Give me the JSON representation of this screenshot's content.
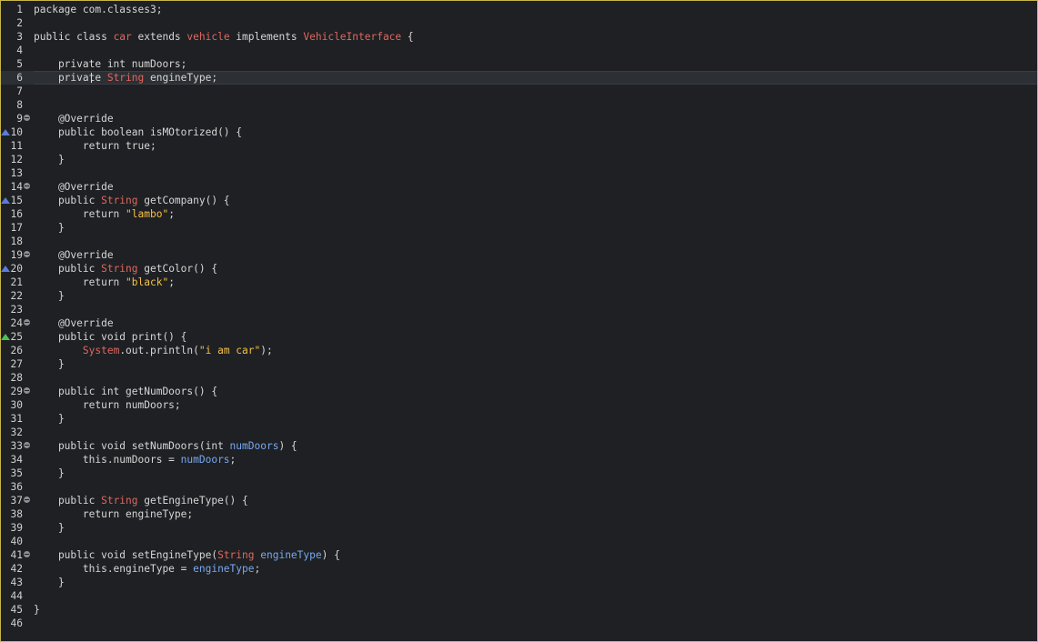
{
  "editor": {
    "border_color": "#c8b54a",
    "background": "#1e2023",
    "colors": {
      "default": "#d6d6d6",
      "type": "#e0675f",
      "string": "#f5c049",
      "field": "#79a8ee",
      "line_number": "#d0d0d0",
      "marker_blue": "#5b7cd8",
      "marker_green": "#4fbf57"
    },
    "current_line": 6,
    "lines": [
      {
        "n": "1",
        "tokens": [
          {
            "t": "package com.classes3;",
            "c": "default"
          }
        ]
      },
      {
        "n": "2",
        "tokens": []
      },
      {
        "n": "3",
        "tokens": [
          {
            "t": "public class ",
            "c": "default"
          },
          {
            "t": "car",
            "c": "type"
          },
          {
            "t": " extends ",
            "c": "default"
          },
          {
            "t": "vehicle",
            "c": "type"
          },
          {
            "t": " implements ",
            "c": "default"
          },
          {
            "t": "VehicleInterface",
            "c": "type"
          },
          {
            "t": " {",
            "c": "default"
          }
        ]
      },
      {
        "n": "4",
        "tokens": []
      },
      {
        "n": "5",
        "tokens": [
          {
            "t": "    private int numDoors;",
            "c": "default"
          }
        ]
      },
      {
        "n": "6",
        "tokens": [
          {
            "t": "    private ",
            "c": "default"
          },
          {
            "t": "String",
            "c": "type"
          },
          {
            "t": " engineType;",
            "c": "default"
          }
        ]
      },
      {
        "n": "7",
        "tokens": []
      },
      {
        "n": "8",
        "tokens": []
      },
      {
        "n": "9",
        "fold": true,
        "tokens": [
          {
            "t": "    @Override",
            "c": "default"
          }
        ]
      },
      {
        "n": "10",
        "marker": "blue",
        "tokens": [
          {
            "t": "    public boolean isMOtorized() {",
            "c": "default"
          }
        ]
      },
      {
        "n": "11",
        "tokens": [
          {
            "t": "        return true;",
            "c": "default"
          }
        ]
      },
      {
        "n": "12",
        "tokens": [
          {
            "t": "    }",
            "c": "default"
          }
        ]
      },
      {
        "n": "13",
        "tokens": []
      },
      {
        "n": "14",
        "fold": true,
        "tokens": [
          {
            "t": "    @Override",
            "c": "default"
          }
        ]
      },
      {
        "n": "15",
        "marker": "blue",
        "tokens": [
          {
            "t": "    public ",
            "c": "default"
          },
          {
            "t": "String",
            "c": "type"
          },
          {
            "t": " getCompany() {",
            "c": "default"
          }
        ]
      },
      {
        "n": "16",
        "tokens": [
          {
            "t": "        return ",
            "c": "default"
          },
          {
            "t": "\"lambo\"",
            "c": "string"
          },
          {
            "t": ";",
            "c": "default"
          }
        ]
      },
      {
        "n": "17",
        "tokens": [
          {
            "t": "    }",
            "c": "default"
          }
        ]
      },
      {
        "n": "18",
        "tokens": []
      },
      {
        "n": "19",
        "fold": true,
        "tokens": [
          {
            "t": "    @Override",
            "c": "default"
          }
        ]
      },
      {
        "n": "20",
        "marker": "blue",
        "tokens": [
          {
            "t": "    public ",
            "c": "default"
          },
          {
            "t": "String",
            "c": "type"
          },
          {
            "t": " getColor() {",
            "c": "default"
          }
        ]
      },
      {
        "n": "21",
        "tokens": [
          {
            "t": "        return ",
            "c": "default"
          },
          {
            "t": "\"black\"",
            "c": "string"
          },
          {
            "t": ";",
            "c": "default"
          }
        ]
      },
      {
        "n": "22",
        "tokens": [
          {
            "t": "    }",
            "c": "default"
          }
        ]
      },
      {
        "n": "23",
        "tokens": []
      },
      {
        "n": "24",
        "fold": true,
        "tokens": [
          {
            "t": "    @Override",
            "c": "default"
          }
        ]
      },
      {
        "n": "25",
        "marker": "green",
        "tokens": [
          {
            "t": "    public void print() {",
            "c": "default"
          }
        ]
      },
      {
        "n": "26",
        "tokens": [
          {
            "t": "        ",
            "c": "default"
          },
          {
            "t": "System",
            "c": "type"
          },
          {
            "t": ".out.println(",
            "c": "default"
          },
          {
            "t": "\"i am car\"",
            "c": "string"
          },
          {
            "t": ");",
            "c": "default"
          }
        ]
      },
      {
        "n": "27",
        "tokens": [
          {
            "t": "    }",
            "c": "default"
          }
        ]
      },
      {
        "n": "28",
        "tokens": []
      },
      {
        "n": "29",
        "fold": true,
        "tokens": [
          {
            "t": "    public int getNumDoors() {",
            "c": "default"
          }
        ]
      },
      {
        "n": "30",
        "tokens": [
          {
            "t": "        return numDoors;",
            "c": "default"
          }
        ]
      },
      {
        "n": "31",
        "tokens": [
          {
            "t": "    }",
            "c": "default"
          }
        ]
      },
      {
        "n": "32",
        "tokens": []
      },
      {
        "n": "33",
        "fold": true,
        "tokens": [
          {
            "t": "    public void setNumDoors(int ",
            "c": "default"
          },
          {
            "t": "numDoors",
            "c": "field"
          },
          {
            "t": ") {",
            "c": "default"
          }
        ]
      },
      {
        "n": "34",
        "tokens": [
          {
            "t": "        this.numDoors = ",
            "c": "default"
          },
          {
            "t": "numDoors",
            "c": "field"
          },
          {
            "t": ";",
            "c": "default"
          }
        ]
      },
      {
        "n": "35",
        "tokens": [
          {
            "t": "    }",
            "c": "default"
          }
        ]
      },
      {
        "n": "36",
        "tokens": []
      },
      {
        "n": "37",
        "fold": true,
        "tokens": [
          {
            "t": "    public ",
            "c": "default"
          },
          {
            "t": "String",
            "c": "type"
          },
          {
            "t": " getEngineType() {",
            "c": "default"
          }
        ]
      },
      {
        "n": "38",
        "tokens": [
          {
            "t": "        return engineType;",
            "c": "default"
          }
        ]
      },
      {
        "n": "39",
        "tokens": [
          {
            "t": "    }",
            "c": "default"
          }
        ]
      },
      {
        "n": "40",
        "tokens": []
      },
      {
        "n": "41",
        "fold": true,
        "tokens": [
          {
            "t": "    public void setEngineType(",
            "c": "default"
          },
          {
            "t": "String",
            "c": "type"
          },
          {
            "t": " ",
            "c": "default"
          },
          {
            "t": "engineType",
            "c": "field"
          },
          {
            "t": ") {",
            "c": "default"
          }
        ]
      },
      {
        "n": "42",
        "tokens": [
          {
            "t": "        this.engineType = ",
            "c": "default"
          },
          {
            "t": "engineType",
            "c": "field"
          },
          {
            "t": ";",
            "c": "default"
          }
        ]
      },
      {
        "n": "43",
        "tokens": [
          {
            "t": "    }",
            "c": "default"
          }
        ]
      },
      {
        "n": "44",
        "tokens": []
      },
      {
        "n": "45",
        "tokens": [
          {
            "t": "}",
            "c": "default"
          }
        ]
      },
      {
        "n": "46",
        "tokens": []
      }
    ]
  }
}
